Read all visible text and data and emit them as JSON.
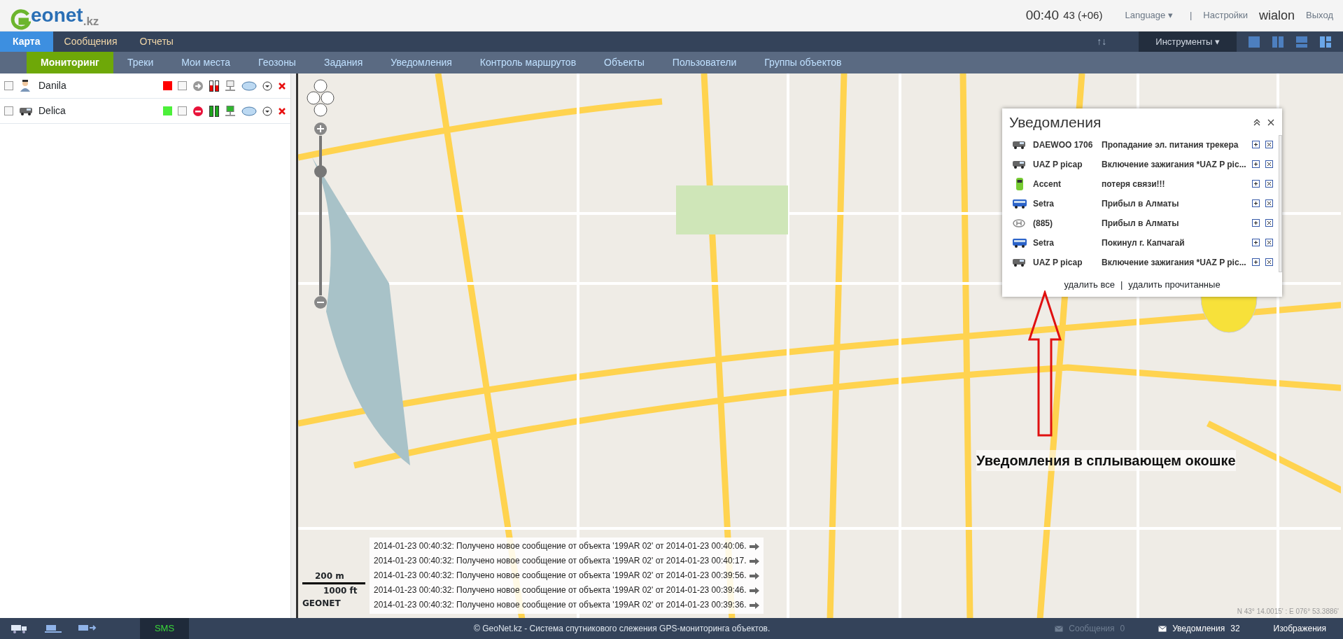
{
  "header": {
    "logo": {
      "name": "eonet",
      "suffix": ".kz"
    },
    "time": "00:40",
    "time_extra": "43 (+06)",
    "language": "Language",
    "language_caret": "▾",
    "separator": "|",
    "settings": "Настройки",
    "brand": "wialon",
    "logout": "Выход"
  },
  "main_tabs": [
    {
      "label": "Карта",
      "selected": true
    },
    {
      "label": "Сообщения",
      "selected": false
    },
    {
      "label": "Отчеты",
      "selected": false
    }
  ],
  "toolbar": {
    "sort": "↑↓",
    "tools": "Инструменты",
    "tools_caret": "▾"
  },
  "sub_tabs": [
    {
      "label": "Мониторинг",
      "selected": true
    },
    {
      "label": "Треки",
      "selected": false
    },
    {
      "label": "Мои места",
      "selected": false
    },
    {
      "label": "Геозоны",
      "selected": false
    },
    {
      "label": "Задания",
      "selected": false
    },
    {
      "label": "Уведомления",
      "selected": false
    },
    {
      "label": "Контроль маршрутов",
      "selected": false
    },
    {
      "label": "Объекты",
      "selected": false
    },
    {
      "label": "Пользователи",
      "selected": false
    },
    {
      "label": "Группы объектов",
      "selected": false
    }
  ],
  "units": [
    {
      "name": "Danila",
      "kind": "person",
      "checked": false,
      "color": "#ff0000",
      "on_map": false,
      "stopped": false,
      "online": false
    },
    {
      "name": "Delica",
      "kind": "van",
      "checked": false,
      "color": "#4cf03a",
      "on_map": false,
      "stopped": true,
      "online": true
    }
  ],
  "notifications": {
    "title": "Уведомления",
    "items": [
      {
        "kind": "van",
        "unit": "DAEWOO 1706",
        "text": "Пропадание эл. питания трекера"
      },
      {
        "kind": "van",
        "unit": "UAZ P picap",
        "text": "Включение зажигания *UAZ P pic..."
      },
      {
        "kind": "car",
        "unit": "Accent",
        "text": "потеря связи!!!"
      },
      {
        "kind": "bus",
        "unit": "Setra",
        "text": "Прибыл в Алматы"
      },
      {
        "kind": "logo",
        "unit": "(885)",
        "text": "Прибыл в Алматы"
      },
      {
        "kind": "bus",
        "unit": "Setra",
        "text": "Покинул г. Капчагай"
      },
      {
        "kind": "van",
        "unit": "UAZ P picap",
        "text": "Включение зажигания *UAZ P pic..."
      }
    ],
    "delete_all": "удалить все",
    "separator": "|",
    "delete_read": "удалить прочитанные"
  },
  "map": {
    "zoom": {
      "level": 0.8
    },
    "caption": "Уведомления в сплывающем окошке",
    "scale_metric": "200 m",
    "scale_imperial": "1000 ft",
    "scale_brand": "GEONET",
    "coordinates": "N 43° 14.0015' : E 076° 53.3886'"
  },
  "log": [
    "2014-01-23 00:40:32: Получено новое сообщение от объекта '199AR 02' от 2014-01-23 00:40:06.",
    "2014-01-23 00:40:32: Получено новое сообщение от объекта '199AR 02' от 2014-01-23 00:40:17.",
    "2014-01-23 00:40:32: Получено новое сообщение от объекта '199AR 02' от 2014-01-23 00:39:56.",
    "2014-01-23 00:40:32: Получено новое сообщение от объекта '199AR 02' от 2014-01-23 00:39:46.",
    "2014-01-23 00:40:32: Получено новое сообщение от объекта '199AR 02' от 2014-01-23 00:39:36."
  ],
  "footer": {
    "sms": "SMS",
    "copyright": "© GeoNet.kz - Система спутникового слежения GPS-мониторинга объектов.",
    "messages": {
      "label": "Сообщения",
      "count": "0",
      "disabled": true
    },
    "notifications": {
      "label": "Уведомления",
      "count": "32",
      "disabled": false
    },
    "images": "Изображения"
  }
}
